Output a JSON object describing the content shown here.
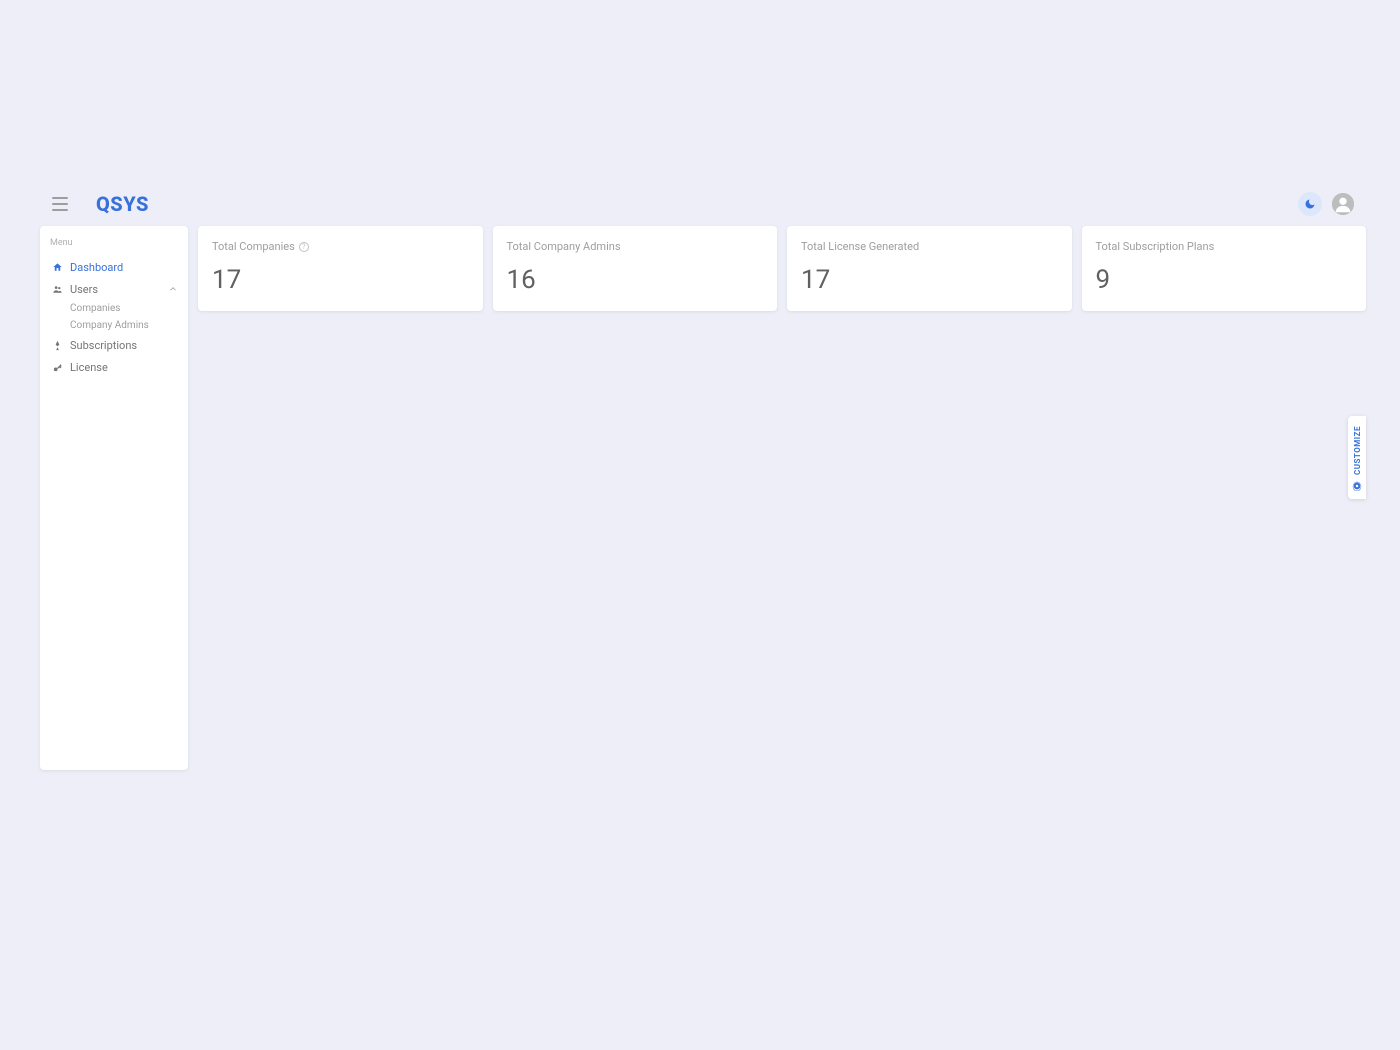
{
  "header": {
    "logo": "QSYS"
  },
  "sidebar": {
    "section_label": "Menu",
    "items": [
      {
        "label": "Dashboard"
      },
      {
        "label": "Users"
      },
      {
        "label": "Subscriptions"
      },
      {
        "label": "License"
      }
    ],
    "users_subitems": [
      {
        "label": "Companies"
      },
      {
        "label": "Company Admins"
      }
    ]
  },
  "cards": [
    {
      "title": "Total Companies",
      "value": "17",
      "has_info": true
    },
    {
      "title": "Total Company Admins",
      "value": "16",
      "has_info": false
    },
    {
      "title": "Total License Generated",
      "value": "17",
      "has_info": false
    },
    {
      "title": "Total Subscription Plans",
      "value": "9",
      "has_info": false
    }
  ],
  "customize": {
    "label": "CUSTOMIZE"
  }
}
